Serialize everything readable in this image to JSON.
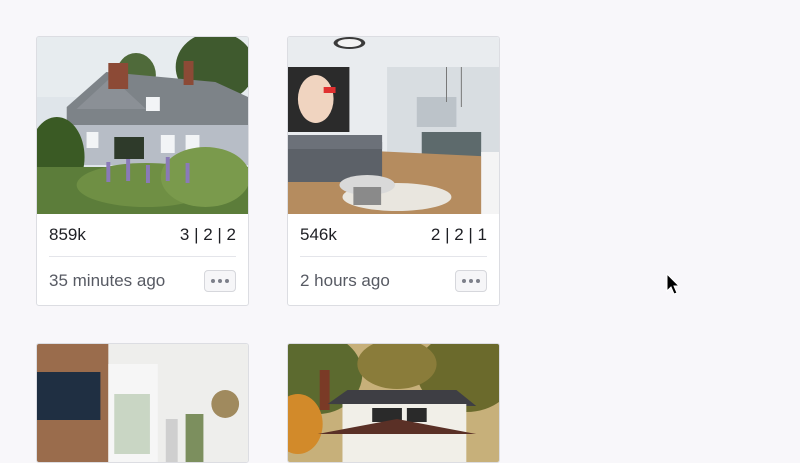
{
  "listings": [
    {
      "price": "859k",
      "beds_baths": "3 | 2 | 2",
      "posted": "35 minutes ago",
      "image": "farmhouse-with-garden"
    },
    {
      "price": "546k",
      "beds_baths": "2 | 2 | 1",
      "posted": "2 hours ago",
      "image": "modern-living-room-kitchen"
    },
    {
      "image": "interior-with-tv-wall"
    },
    {
      "image": "house-among-autumn-trees"
    }
  ],
  "icons": {
    "more": "more-horizontal-icon",
    "cursor": "mouse-pointer-icon"
  },
  "colors": {
    "background": "#f8f7fa",
    "card_border": "#dcdde2",
    "text": "#1e1f24",
    "muted_text": "#575a63"
  }
}
